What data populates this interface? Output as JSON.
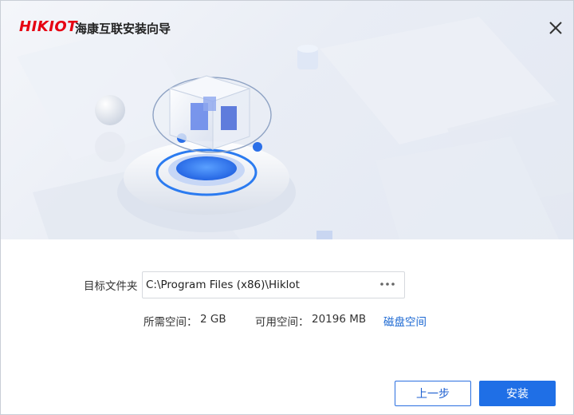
{
  "app": {
    "logo_text": "HIKIOT",
    "title": "海康互联安装向导"
  },
  "form": {
    "folder_label": "目标文件夹",
    "folder_value": "C:\\Program Files (x86)\\Hiklot",
    "required_label": "所需空间：",
    "required_value": "2 GB",
    "available_label": "可用空间：",
    "available_value": "20196 MB",
    "disk_space_link": "磁盘空间"
  },
  "buttons": {
    "prev": "上一步",
    "install": "安装"
  },
  "colors": {
    "brand_red": "#e60012",
    "accent_blue": "#1f6fe6",
    "link_blue": "#1a67d2"
  }
}
